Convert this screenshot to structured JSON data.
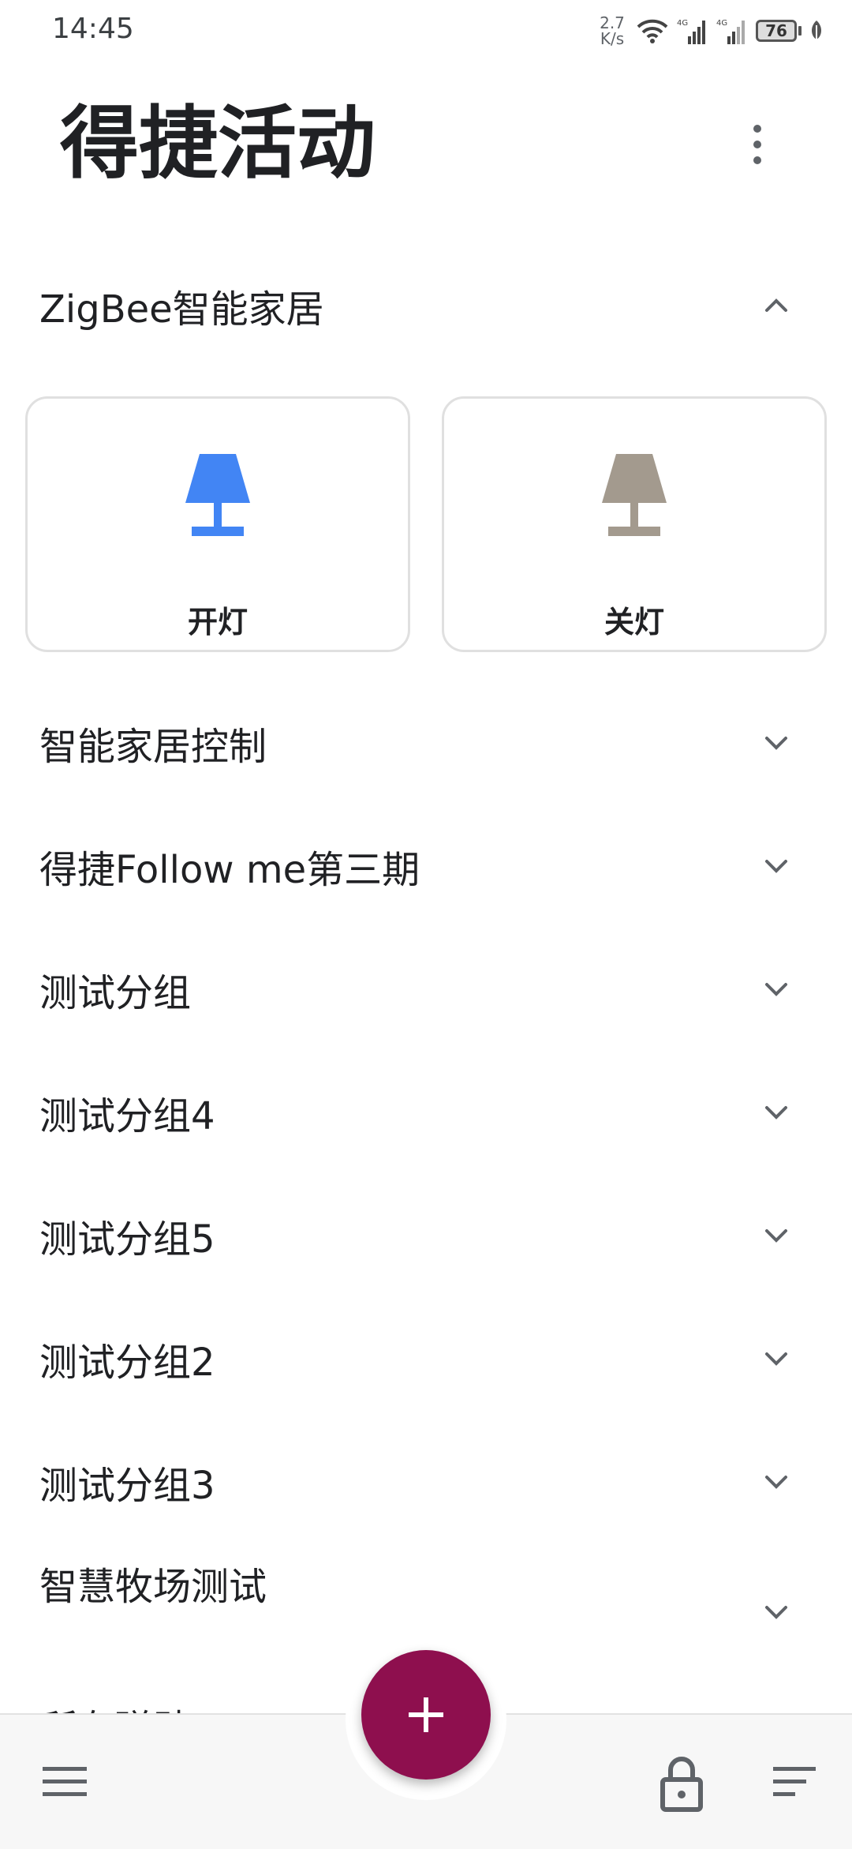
{
  "status_bar": {
    "time": "14:45",
    "net_speed_value": "2.7",
    "net_speed_unit": "K/s",
    "signal1_label": "4G",
    "signal2_label": "4G",
    "battery_level": "76"
  },
  "header": {
    "title": "得捷活动",
    "more_icon": "more-vert-icon"
  },
  "groups": [
    {
      "label": "ZigBee智能家居",
      "expanded": true
    },
    {
      "label": "智能家居控制",
      "expanded": false
    },
    {
      "label": "得捷Follow me第三期",
      "expanded": false
    },
    {
      "label": "测试分组",
      "expanded": false
    },
    {
      "label": "测试分组4",
      "expanded": false
    },
    {
      "label": "测试分组5",
      "expanded": false
    },
    {
      "label": "测试分组2",
      "expanded": false
    },
    {
      "label": "测试分组3",
      "expanded": false
    },
    {
      "label": "智慧牧场测试",
      "expanded": false
    }
  ],
  "shortcuts": [
    {
      "label": "开灯",
      "icon": "lamp-icon",
      "color": "#4285f4"
    },
    {
      "label": "关灯",
      "icon": "lamp-icon",
      "color": "#a39a8e"
    }
  ],
  "partial_group_label": "所有磁贴",
  "bottom_bar": {
    "menu_icon": "menu-icon",
    "fab_icon": "plus-icon",
    "fab_color": "#8e0f4e",
    "lock_icon": "lock-icon",
    "sort_icon": "sort-icon"
  }
}
